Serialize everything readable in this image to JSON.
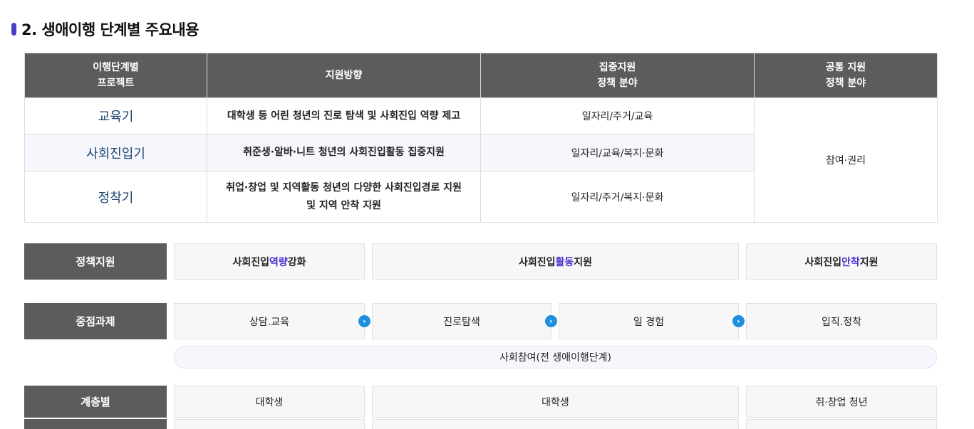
{
  "section": {
    "title": "2. 생애이행 단계별 주요내용"
  },
  "table": {
    "headers": [
      "이행단계별\n프로젝트",
      "지원방향",
      "집중지원\n정책 분야",
      "공통 지원\n정책 분야"
    ],
    "rows": [
      {
        "stage": "교육기",
        "direction": "대학생 등 어린 청년의 진로 탐색 및 사회진입 역량 제고",
        "focus": "일자리/주거/교육"
      },
      {
        "stage": "사회진입기",
        "direction": "취준생·알바·니트 청년의 사회진입활동 집중지원",
        "focus": "일자리/교육/복지·문화"
      },
      {
        "stage": "정착기",
        "direction": "취업·창업 및 지역활동 청년의 다양한 사회진입경로 지원\n및 지역 안착 지원",
        "focus": "일자리/주거/복지·문화"
      }
    ],
    "common": "참여·권리"
  },
  "policy": {
    "label": "정책지원",
    "items": [
      {
        "pre": "사회진입 ",
        "hl": "역량",
        "post": " 강화"
      },
      {
        "pre": "사회진입 ",
        "hl": "활동",
        "post": " 지원"
      },
      {
        "pre": "사회진입 ",
        "hl": "안착",
        "post": " 지원"
      }
    ]
  },
  "tasks": {
    "label": "중점과제",
    "items": [
      "상담.교육",
      "진로탐색",
      "일 경험",
      "입직.정착"
    ],
    "participation": "사회참여(전 생애이행단계)"
  },
  "strata": {
    "label": "계층별",
    "items": [
      "대학생",
      "대학생",
      "취·창업 청년"
    ]
  },
  "colors": {
    "header_bg": "#5c5c5c",
    "accent": "#4a2fd1",
    "arrow": "#1f8fe0",
    "stage_text": "#1e4673"
  },
  "icons": {
    "arrow": "chevron-right-circle-icon",
    "title_marker": "section-marker-icon"
  }
}
